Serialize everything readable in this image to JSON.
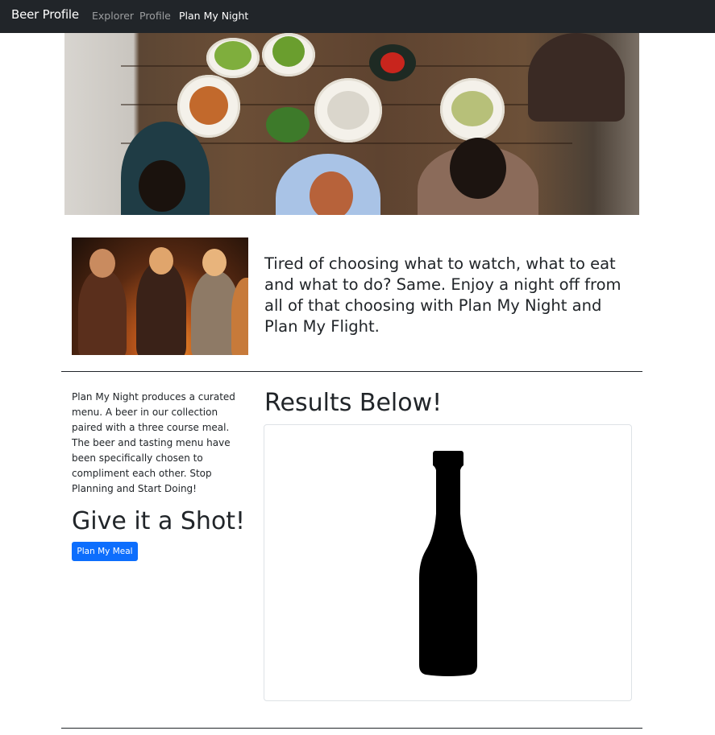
{
  "navbar": {
    "brand": "Beer Profile",
    "links": [
      {
        "label": "Explorer",
        "active": false
      },
      {
        "label": "Profile",
        "active": false
      },
      {
        "label": "Plan My Night",
        "active": true
      }
    ]
  },
  "hero": {
    "image": "dinner-table-photo"
  },
  "intro": {
    "image": "campfire-friends-photo",
    "text": "Tired of choosing what to watch, what to eat and what to do? Same. Enjoy a night off from all of that choosing with Plan My Night and Plan My Flight."
  },
  "sidebar": {
    "description": "Plan My Night produces a curated menu. A beer in our collection paired with a three course meal. The beer and tasting menu have been specifically chosen to compliment each other. Stop Planning and Start Doing!",
    "heading": "Give it a Shot!",
    "button_label": "Plan My Meal"
  },
  "results": {
    "heading": "Results Below!",
    "image": "beer-bottle-silhouette"
  },
  "colors": {
    "navbar_bg": "#212529",
    "primary": "#0d6efd",
    "text": "#212529"
  }
}
